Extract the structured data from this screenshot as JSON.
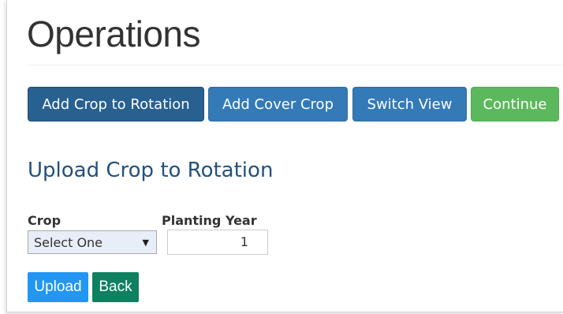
{
  "page": {
    "title": "Operations"
  },
  "toolbar": {
    "add_crop_label": "Add Crop to Rotation",
    "add_cover_crop_label": "Add Cover Crop",
    "switch_view_label": "Switch View",
    "continue_label": "Continue"
  },
  "form": {
    "section_title": "Upload Crop to Rotation",
    "crop_label": "Crop",
    "crop_selected": "Select One",
    "planting_year_label": "Planting Year",
    "planting_year_value": "1",
    "upload_label": "Upload",
    "back_label": "Back"
  },
  "colors": {
    "primary_dark": "#286090",
    "primary": "#337ab7",
    "success": "#5cb85c",
    "upload": "#2196f3",
    "back": "#0f8060",
    "section_title": "#23527c"
  }
}
